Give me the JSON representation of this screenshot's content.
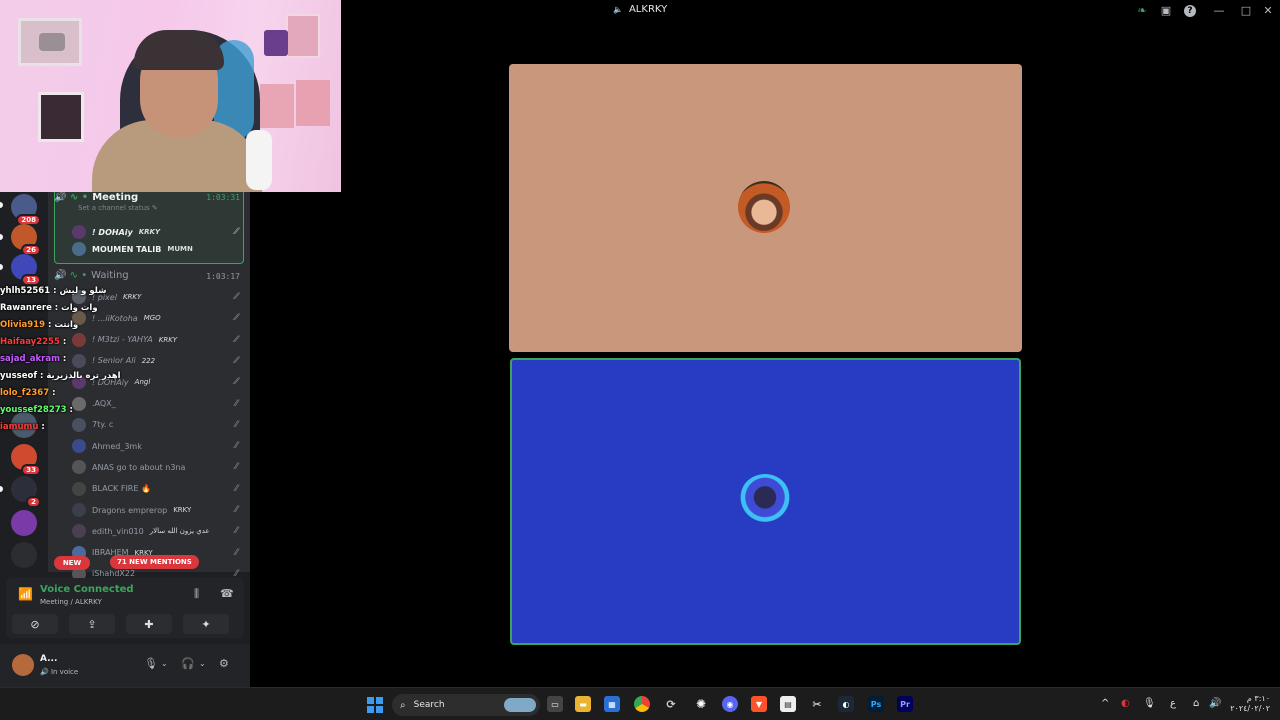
{
  "window": {
    "title": "ALKRKY"
  },
  "servers": [
    {
      "badge": "208"
    },
    {
      "badge": "26"
    },
    {
      "badge": "13"
    },
    {
      "badge": ""
    },
    {
      "badge": ""
    },
    {
      "badge": "33"
    },
    {
      "badge": "2"
    },
    {
      "badge": ""
    }
  ],
  "channels": {
    "meeting": {
      "name": "Meeting",
      "time": "1:03:31",
      "status": "Set a channel status",
      "members": [
        {
          "name": "! DOHAiy",
          "tag": "KRKY"
        },
        {
          "name": "MOUMEN TALIB",
          "tag": "MUMN"
        }
      ]
    },
    "waiting": {
      "name": "Waiting",
      "time": "1:03:17",
      "members": [
        {
          "name": "! pixel",
          "tag": "KRKY"
        },
        {
          "name": "! ...iiKotoha",
          "tag": "MGO"
        },
        {
          "name": "! M3tzi - YAHYA",
          "tag": "KRKY"
        },
        {
          "name": "! Senior Ali",
          "tag": "222"
        },
        {
          "name": "! DOHAiy",
          "tag": "Angl"
        },
        {
          "name": ".AQX_",
          "tag": ""
        },
        {
          "name": "7ty. c",
          "tag": ""
        },
        {
          "name": "Ahmed_3mk",
          "tag": ""
        },
        {
          "name": "ANAS go to about n3na",
          "tag": ""
        },
        {
          "name": "BLACK FIRE 🔥",
          "tag": ""
        },
        {
          "name": "Dragons emprerор",
          "tag": "KRKY"
        },
        {
          "name": "edith_vin010",
          "tag": "عدي يزون الله سالار"
        },
        {
          "name": "IBRAHEM",
          "tag": "KRKY"
        },
        {
          "name": "iShahdX22",
          "tag": ""
        }
      ]
    },
    "new_mentions": "71 NEW MENTIONS",
    "new_badge": "NEW"
  },
  "chat": [
    {
      "user": "yhlh52561",
      "msg": "شلو و ليش",
      "color": "#ffffff"
    },
    {
      "user": "Rawanrere",
      "msg": "وات وات",
      "color": "#ffffff"
    },
    {
      "user": "Olivia919",
      "msg": "وانتت",
      "color": "#ff9d2e"
    },
    {
      "user": "Haifaay2255",
      "msg": "",
      "color": "#ff3b3b"
    },
    {
      "user": "sajad_akram",
      "msg": "",
      "color": "#c55cff"
    },
    {
      "user": "yusseof",
      "msg": "اهدر تره بالدزيرية",
      "color": "#ffffff"
    },
    {
      "user": "lolo_f2367",
      "msg": "",
      "color": "#ff9d2e"
    },
    {
      "user": "youssef28273",
      "msg": "",
      "color": "#5cff6a"
    },
    {
      "user": "iamumu",
      "msg": "",
      "color": "#ff3b3b"
    }
  ],
  "voice": {
    "title": "Voice Connected",
    "sub": "Meeting / ALKRKY"
  },
  "user": {
    "name": "A...",
    "status": "In voice"
  },
  "taskbar": {
    "search_placeholder": "Search",
    "clock_time": "٣:١٠ م",
    "clock_date": "٢٠٢٤/٠٢/٠٢",
    "lang": "ع"
  },
  "colors": {
    "accent": "#3ba55d",
    "danger": "#da373c",
    "top_tile": "#c9977b",
    "bottom_tile": "#283cc3"
  }
}
